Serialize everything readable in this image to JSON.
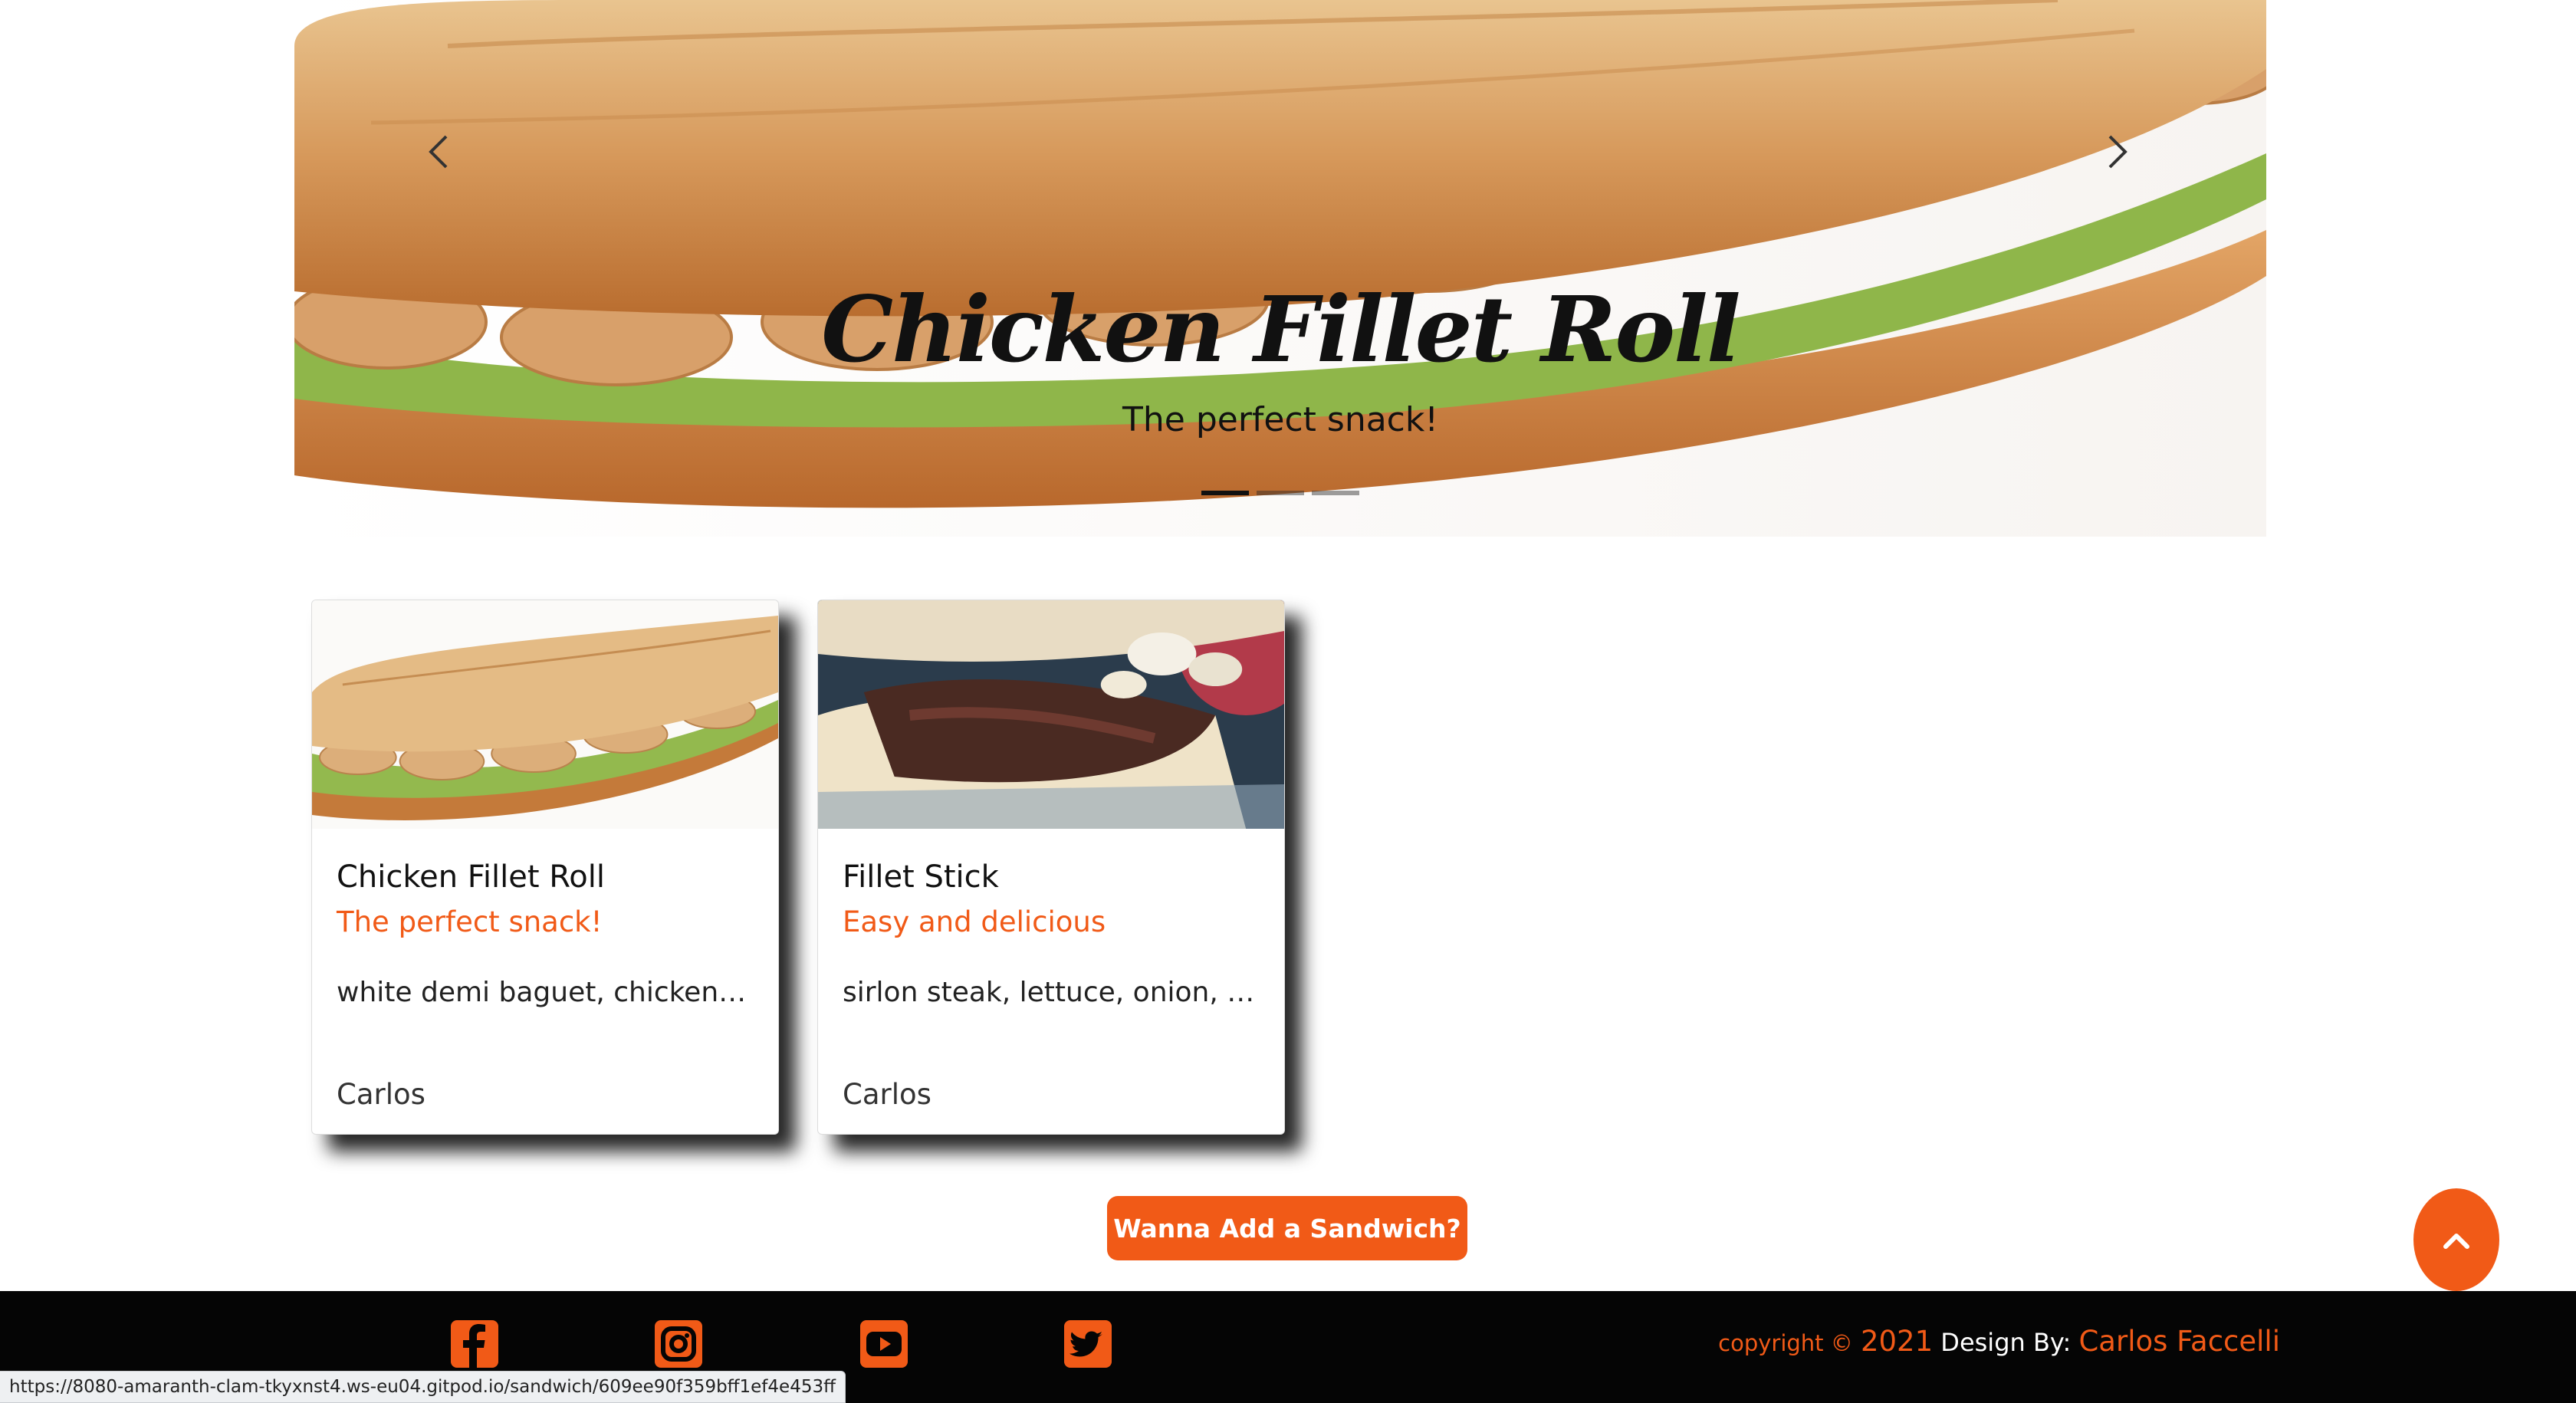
{
  "hero": {
    "title": "Chicken Fillet Roll",
    "subtitle": "The perfect snack!",
    "slides_count": 3,
    "active_slide": 1
  },
  "cards": [
    {
      "title": "Chicken Fillet Roll",
      "subtitle": "The perfect snack!",
      "description": "white demi baguet, chicken fillet, lettuce, mayo",
      "author": "Carlos"
    },
    {
      "title": "Fillet Stick",
      "subtitle": "Easy and delicious",
      "description": "sirlon steak, lettuce, onion, black pepper",
      "author": "Carlos"
    }
  ],
  "cta": {
    "label": "Wanna Add a Sandwich?"
  },
  "footer": {
    "social_icons": [
      "facebook-icon",
      "instagram-icon",
      "youtube-icon",
      "twitter-icon"
    ],
    "copyright_prefix": "copyright ©",
    "year": "2021",
    "design_by": "Design By:",
    "designer": "Carlos Faccelli"
  },
  "status_url": "https://8080-amaranth-clam-tkyxnst4.ws-eu04.gitpod.io/sandwich/609ee90f359bff1ef4e453ff",
  "colors": {
    "accent": "#f15a17",
    "footer_bg": "#050505"
  }
}
